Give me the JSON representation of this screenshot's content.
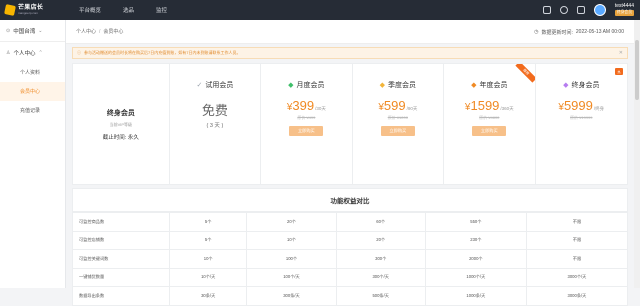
{
  "header": {
    "logo_title": "芒果店长",
    "logo_sub": "mangoerp.com",
    "nav": [
      "平台概览",
      "选品",
      "监控"
    ],
    "username": "test4444",
    "user_badge": "终身会员"
  },
  "sidebar": {
    "region": "中国台湾",
    "group": "个人中心",
    "items": [
      {
        "label": "个人资料",
        "active": false
      },
      {
        "label": "会员中心",
        "active": true
      },
      {
        "label": "充值记录",
        "active": false
      }
    ]
  },
  "breadcrumb": [
    "个人中心",
    "会员中心"
  ],
  "update_label": "数据更新时间:",
  "update_time": "2022-05-13 AM 00:00",
  "notice": "参与活动赠送的会员时长将在购买后7日内充值到账，如有7日内未到账请联系工作人员。",
  "current_plan": {
    "title": "终身会员",
    "sub": "当前VIP等级",
    "expiry": "截止时间: 永久"
  },
  "plans": [
    {
      "name": "试用会员",
      "icon": "✓",
      "icon_color": "#9aa2ad",
      "free": "免费",
      "free_sub": "( 3 天 )"
    },
    {
      "name": "月度会员",
      "icon": "◆",
      "icon_color": "#3fbf6a",
      "currency": "¥",
      "price": "399",
      "per": "/30天",
      "orig": "原价 ¥499",
      "buy": "立即购买"
    },
    {
      "name": "季度会员",
      "icon": "◆",
      "icon_color": "#f2b53b",
      "currency": "¥",
      "price": "599",
      "per": "/90天",
      "orig": "原价 ¥1200",
      "buy": "立即购买"
    },
    {
      "name": "年度会员",
      "icon": "◆",
      "icon_color": "#f08a24",
      "currency": "¥",
      "price": "1599",
      "per": "/360天",
      "orig": "原价 ¥4800",
      "buy": "立即购买",
      "ribbon": "推荐"
    },
    {
      "name": "终身会员",
      "icon": "◆",
      "icon_color": "#b67cf0",
      "currency": "¥",
      "price": "5999",
      "per": "/终身",
      "orig": "原价 ¥19999",
      "tag": "热"
    }
  ],
  "compare_title": "功能权益对比",
  "compare_rows": [
    {
      "label": "可监控商品数",
      "values": [
        "5个",
        "20个",
        "60个",
        "550个",
        "不限"
      ]
    },
    {
      "label": "可监控店铺数",
      "values": [
        "5个",
        "10个",
        "20个",
        "230个",
        "不限"
      ]
    },
    {
      "label": "可监控关键词数",
      "values": [
        "10个",
        "100个",
        "300个",
        "2000个",
        "不限"
      ]
    },
    {
      "label": "一键铺货数量",
      "values": [
        "10个/天",
        "100个/天",
        "300个/天",
        "1000个/天",
        "3000个/天"
      ]
    },
    {
      "label": "数据导出条数",
      "values": [
        "30条/天",
        "300条/天",
        "500条/天",
        "1000条/天",
        "3000条/天"
      ]
    }
  ]
}
